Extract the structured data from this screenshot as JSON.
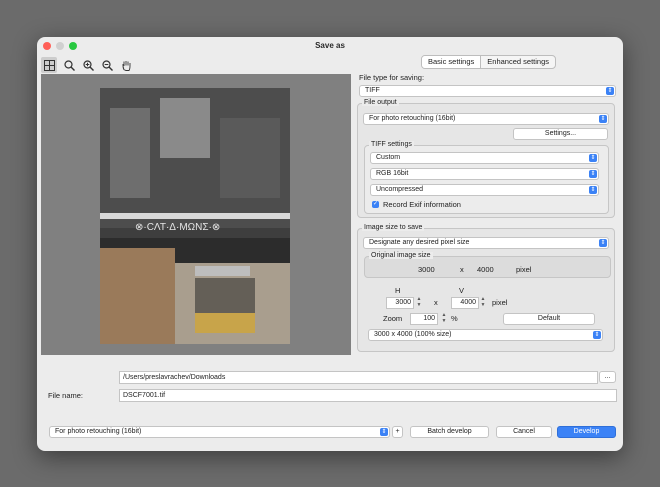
{
  "window": {
    "title": "Save as"
  },
  "toolbar": {
    "icons": [
      "grid-view-icon",
      "magnifier-icon",
      "zoom-in-icon",
      "zoom-out-icon",
      "hand-icon"
    ]
  },
  "tabs": [
    {
      "label": "Basic settings",
      "active": true
    },
    {
      "label": "Enhanced settings",
      "active": false
    }
  ],
  "file_type": {
    "label": "File type for saving:",
    "value": "TIFF"
  },
  "file_output": {
    "legend": "File output",
    "value": "For photo retouching (16bit)",
    "settings_button": "Settings..."
  },
  "tiff_settings": {
    "legend": "TIFF settings",
    "preset": "Custom",
    "color": "RGB 16bit",
    "compression": "Uncompressed",
    "exif_label": "Record Exif information",
    "exif_checked": true
  },
  "image_size": {
    "legend": "Image size to save",
    "mode": "Designate any desired pixel size",
    "original_legend": "Original image size",
    "orig_w": "3000",
    "times": "x",
    "orig_h": "4000",
    "orig_unit": "pixel",
    "h_label": "H",
    "v_label": "V",
    "w_value": "3000",
    "h_value": "4000",
    "x_sep": "x",
    "unit": "pixel",
    "zoom_label": "Zoom",
    "zoom_value": "100",
    "zoom_unit": "%",
    "default_button": "Default",
    "size_preset": "3000 x  4000  (100% size)"
  },
  "paths": {
    "folder": "/Users/preslavrachev/Downloads",
    "browse_button": "...",
    "file_name_label": "File name:",
    "file_name": "DSCF7001.tif"
  },
  "bottom": {
    "preset": "For photo retouching (16bit)",
    "add_button": "+",
    "batch_button": "Batch develop",
    "cancel_button": "Cancel",
    "develop_button": "Develop"
  },
  "colors": {
    "accent": "#3b82f6",
    "background": "#6b6b6b",
    "panel": "#ececec"
  }
}
